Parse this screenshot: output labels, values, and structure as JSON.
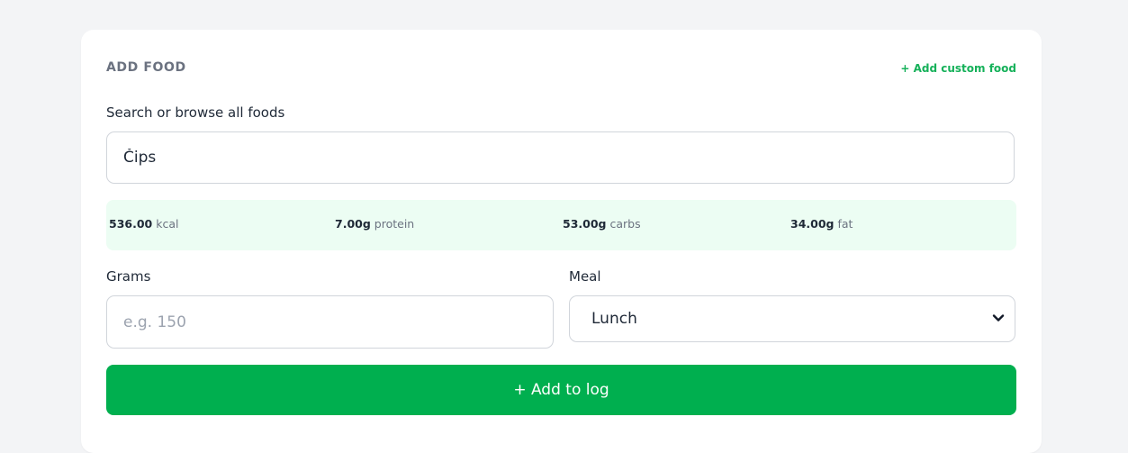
{
  "add_food": {
    "title": "ADD FOOD",
    "custom_link": "+ Add custom food",
    "search_label": "Search or browse all foods",
    "search_value": "Čips",
    "macros": {
      "kcal_value": "536.00",
      "kcal_unit": "kcal",
      "protein_value": "7.00g",
      "protein_unit": "protein",
      "carbs_value": "53.00g",
      "carbs_unit": "carbs",
      "fat_value": "34.00g",
      "fat_unit": "fat"
    },
    "grams_label": "Grams",
    "grams_placeholder": "e.g. 150",
    "grams_value": "",
    "meal_label": "Meal",
    "meal_selected": "Lunch",
    "add_button": "+ Add to log"
  },
  "colors": {
    "accent": "#00af4f",
    "link": "#16b15a",
    "macro_bg": "#ecfdf3"
  },
  "icons": {
    "meal_dropdown": "chevron-down-icon"
  }
}
